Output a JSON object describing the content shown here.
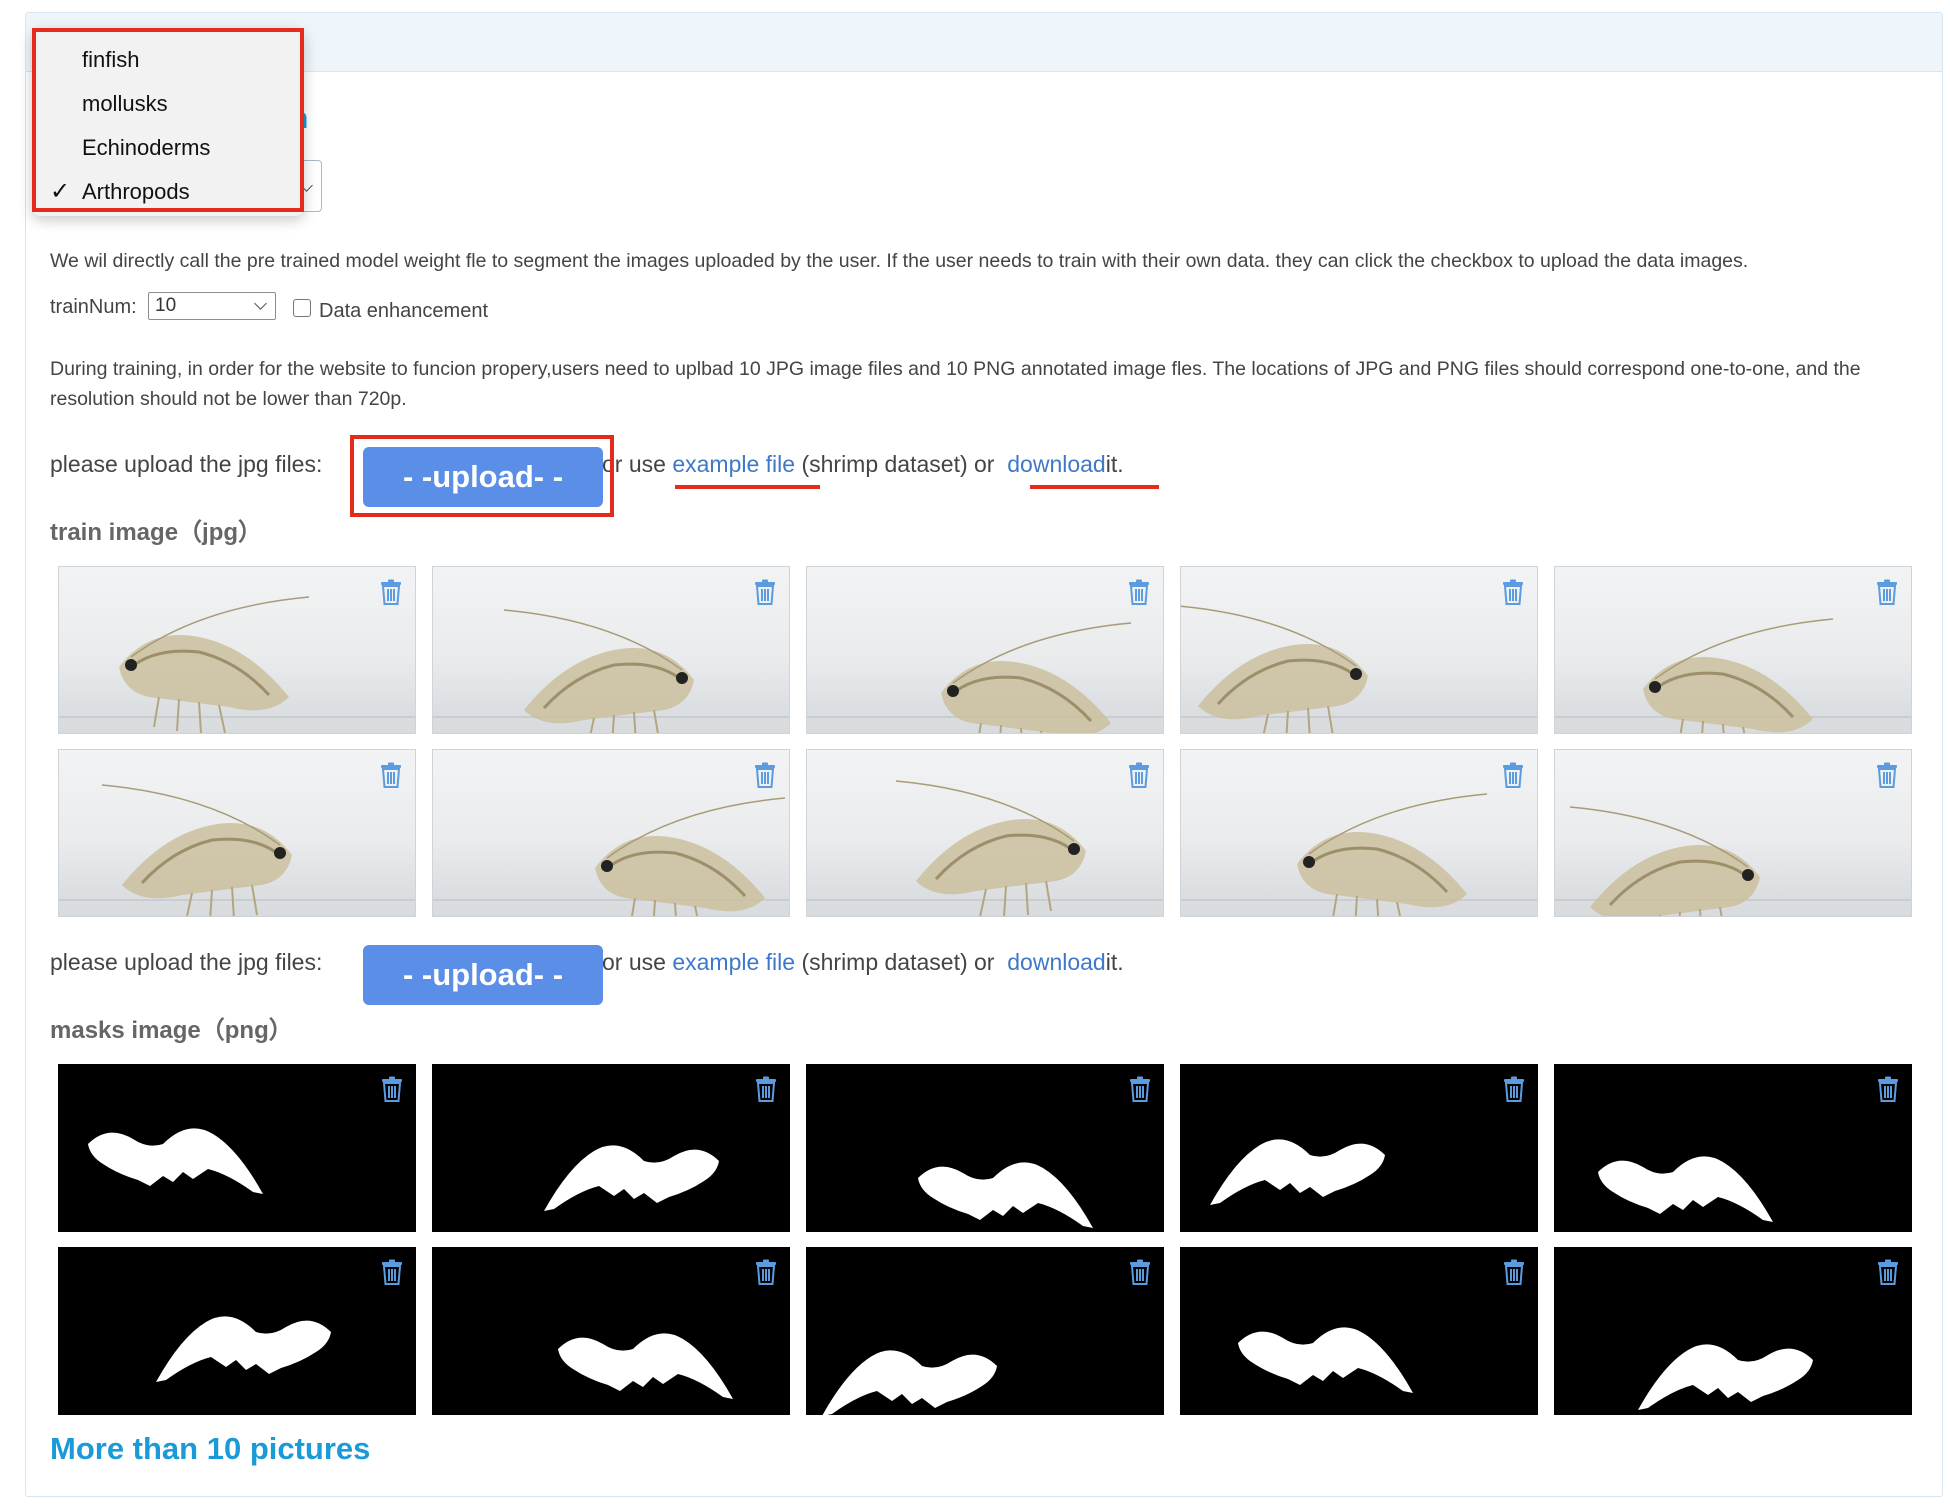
{
  "dropdown": {
    "items": [
      {
        "label": "finfish",
        "selected": false
      },
      {
        "label": "mollusks",
        "selected": false
      },
      {
        "label": "Echinoderms",
        "selected": false
      },
      {
        "label": "Arthropods",
        "selected": true
      }
    ],
    "check": "✓"
  },
  "title_peek": "n",
  "description": "We wil directly call the pre trained model weight fle to segment the images uploaded by the user. If the user needs to train with their own data. they can click the checkbox to upload the data images.",
  "train_num": {
    "label": "trainNum:",
    "value": "10"
  },
  "data_enhancement": {
    "label": "Data enhancement",
    "checked": false
  },
  "training_note": "During training, in order for the website to funcion propery,users need to uplbad 10 JPG image files and 10 PNG annotated image fles. The locations of JPG and PNG files should correspond one-to-one, and the resolution should not be lower than 720p.",
  "upload_jpg": {
    "prompt": "please upload the jpg files:",
    "button": "- -upload- -",
    "or_use": "or use",
    "example_link": "example file",
    "example_suffix": "(shrimp dataset) or",
    "download_link": "download",
    "end": "it."
  },
  "train_section": {
    "title": "train image（jpg）",
    "count": 10
  },
  "upload_png": {
    "prompt": "please upload the jpg files:",
    "button": "- -upload- -",
    "or_use": "or use",
    "example_link": "example file",
    "example_suffix": "(shrimp dataset) or",
    "download_link": "download",
    "end": "it."
  },
  "masks_section": {
    "title": "masks image（png）",
    "count": 10
  },
  "more_link": "More than 10 pictures",
  "icons": {
    "delete": "trash-icon",
    "selected": "checkmark-icon"
  },
  "colors": {
    "accent": "#1a9ad6",
    "button": "#5b8ee6",
    "link": "#3f78c9",
    "highlight": "#e42b1c",
    "trash": "#5b9be0"
  }
}
